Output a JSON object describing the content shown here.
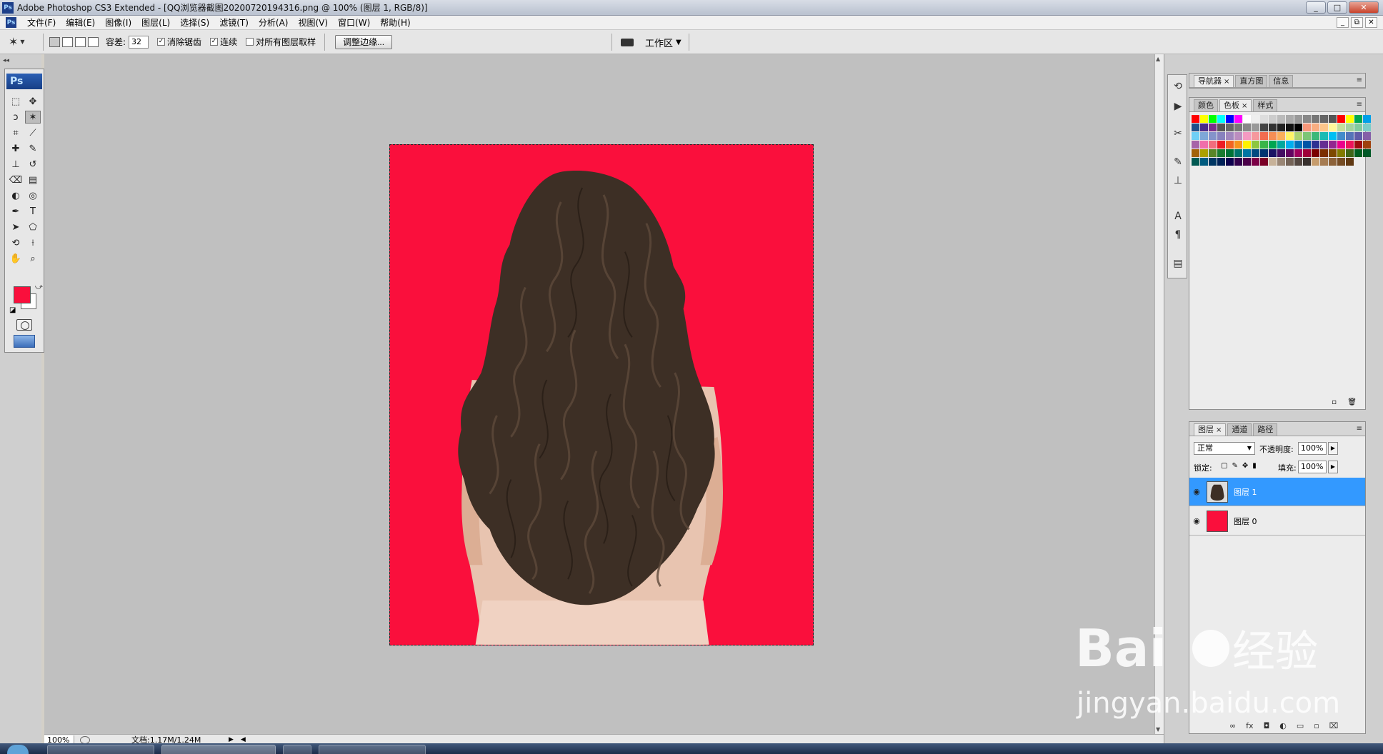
{
  "window": {
    "app_icon": "Ps",
    "title": "Adobe Photoshop CS3 Extended - [QQ浏览器截图20200720194316.png @ 100% (图层 1, RGB/8)]",
    "buttons": {
      "minimize": "_",
      "maximize": "□",
      "close": "✕"
    }
  },
  "menu": {
    "items": [
      "文件(F)",
      "编辑(E)",
      "图像(I)",
      "图层(L)",
      "选择(S)",
      "滤镜(T)",
      "分析(A)",
      "视图(V)",
      "窗口(W)",
      "帮助(H)"
    ],
    "doc_controls": [
      "_",
      "⧉",
      "✕"
    ]
  },
  "options": {
    "tolerance_label": "容差:",
    "tolerance_value": "32",
    "antialias_label": "消除锯齿",
    "antialias_checked": true,
    "contiguous_label": "连续",
    "contiguous_checked": true,
    "sample_all_label": "对所有图层取样",
    "sample_all_checked": false,
    "refine_edge_label": "调整边缘...",
    "workspace_label": "工作区"
  },
  "toolbox": {
    "logo": "Ps",
    "foreground_color": "#fa0f3c",
    "background_color": "#ffffff",
    "tools": [
      {
        "name": "marquee-tool",
        "glyph": "⬚"
      },
      {
        "name": "move-tool",
        "glyph": "✥"
      },
      {
        "name": "lasso-tool",
        "glyph": "ↄ"
      },
      {
        "name": "magic-wand-tool",
        "glyph": "✶"
      },
      {
        "name": "crop-tool",
        "glyph": "⌗"
      },
      {
        "name": "slice-tool",
        "glyph": "⟋"
      },
      {
        "name": "healing-brush-tool",
        "glyph": "✚"
      },
      {
        "name": "brush-tool",
        "glyph": "✎"
      },
      {
        "name": "clone-stamp-tool",
        "glyph": "⊥"
      },
      {
        "name": "history-brush-tool",
        "glyph": "↺"
      },
      {
        "name": "eraser-tool",
        "glyph": "⌫"
      },
      {
        "name": "gradient-tool",
        "glyph": "▤"
      },
      {
        "name": "blur-tool",
        "glyph": "◐"
      },
      {
        "name": "dodge-tool",
        "glyph": "◎"
      },
      {
        "name": "pen-tool",
        "glyph": "✒"
      },
      {
        "name": "type-tool",
        "glyph": "T"
      },
      {
        "name": "path-selection-tool",
        "glyph": "➤"
      },
      {
        "name": "shape-tool",
        "glyph": "⬠"
      },
      {
        "name": "3d-rotate-tool",
        "glyph": "⟲"
      },
      {
        "name": "eyedropper-tool",
        "glyph": "⟊"
      },
      {
        "name": "hand-tool",
        "glyph": "✋"
      },
      {
        "name": "zoom-tool",
        "glyph": "⌕"
      }
    ]
  },
  "status": {
    "zoom": "100%",
    "doc_info": "文档:1.17M/1.24M"
  },
  "panels": {
    "nav_tabs": [
      "导航器",
      "直方图",
      "信息"
    ],
    "swatch_tabs": [
      "颜色",
      "色板",
      "样式"
    ],
    "layer_tabs": [
      "图层",
      "通道",
      "路径"
    ],
    "blend_mode": "正常",
    "opacity_label": "不透明度:",
    "opacity_value": "100%",
    "lock_label": "锁定:",
    "fill_label": "填充:",
    "fill_value": "100%",
    "layers": [
      {
        "name": "图层 1",
        "selected": true
      },
      {
        "name": "图层 0",
        "selected": false
      }
    ],
    "swatches": [
      "#ff0000",
      "#ffff00",
      "#00ff00",
      "#00ffff",
      "#0000ff",
      "#ff00ff",
      "#ffffff",
      "#eeeeee",
      "#dddddd",
      "#cccccc",
      "#bbbbbb",
      "#aaaaaa",
      "#999999",
      "#888888",
      "#777777",
      "#666666",
      "#555555",
      "#ff0000",
      "#ffff00",
      "#00a650",
      "#00a0e9",
      "#1d4e89",
      "#4b2a8a",
      "#7a2e8a",
      "#555555",
      "#666666",
      "#777777",
      "#888888",
      "#999999",
      "#444444",
      "#333333",
      "#222222",
      "#111111",
      "#000000",
      "#f7977a",
      "#f9ad81",
      "#fdc68a",
      "#fff79a",
      "#c4df9b",
      "#a3d39c",
      "#82ca9d",
      "#7bcdc8",
      "#6ecff6",
      "#7ea7d8",
      "#8493ca",
      "#8882be",
      "#a187be",
      "#bc8dbf",
      "#f49ac2",
      "#f6989d",
      "#f26c4f",
      "#f68e55",
      "#fbaf5c",
      "#fff467",
      "#acd372",
      "#7cc576",
      "#3bb878",
      "#1abbb4",
      "#00bff3",
      "#438ccb",
      "#5574b9",
      "#605ca8",
      "#855fa8",
      "#a763a8",
      "#f06ea9",
      "#f26d7d",
      "#ed1c24",
      "#f26522",
      "#f7941d",
      "#fff200",
      "#8dc63f",
      "#39b54a",
      "#00a651",
      "#00a99d",
      "#00aeef",
      "#0072bc",
      "#0054a6",
      "#2e3192",
      "#662d91",
      "#92278f",
      "#ec008c",
      "#ed145b",
      "#9e0b0f",
      "#a0410d",
      "#a36209",
      "#aba000",
      "#598527",
      "#1a7b30",
      "#007236",
      "#00746b",
      "#0076a3",
      "#004b80",
      "#003471",
      "#1b1464",
      "#440e62",
      "#630460",
      "#9e005d",
      "#9e0039",
      "#790000",
      "#7b2e00",
      "#7d4900",
      "#827b00",
      "#406618",
      "#005e20",
      "#005826",
      "#005952",
      "#005b7f",
      "#003663",
      "#002157",
      "#0d004c",
      "#32004b",
      "#4b0049",
      "#7b0046",
      "#7a0026",
      "#c7b299",
      "#998675",
      "#736357",
      "#534741",
      "#37302d",
      "#c69c6d",
      "#a67c52",
      "#8c6239",
      "#754c24",
      "#603913"
    ]
  }
}
